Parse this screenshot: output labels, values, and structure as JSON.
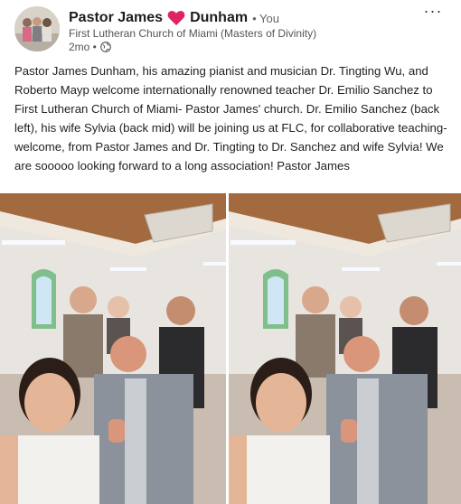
{
  "post": {
    "author": {
      "first_name": "Pastor James",
      "last_name": "Dunham",
      "you_label": "• You",
      "subtitle": "First Lutheran Church of Miami (Masters of Divinity)",
      "time": "2mo •"
    },
    "text": "Pastor James Dunham, his amazing pianist and musician Dr. Tingting Wu, and Roberto Mayp welcome internationally renowned teacher Dr. Emilio Sanchez to First Lutheran Church of Miami- Pastor James' church. Dr. Emilio Sanchez (back left), his wife Sylvia (back mid) will be joining us at FLC, for collaborative teaching- welcome, from Pastor James and Dr. Tingting to Dr. Sanchez and wife Sylvia! We are sooooo looking forward to a long association! Pastor James",
    "more_label": "···",
    "colors": {
      "heart": "#e0245e",
      "accent": "#0a66c2"
    }
  }
}
